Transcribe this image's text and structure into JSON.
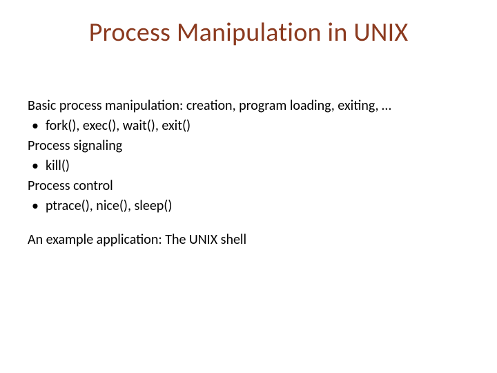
{
  "title": "Process Manipulation in UNIX",
  "lines": {
    "l0": "Basic process manipulation: creation, program loading, exiting, …",
    "b0": "fork(), exec(), wait(), exit()",
    "l1": "Process signaling",
    "b1": "kill()",
    "l2": "Process control",
    "b2": "ptrace(), nice(), sleep()",
    "l3": "An example application: The UNIX shell"
  }
}
